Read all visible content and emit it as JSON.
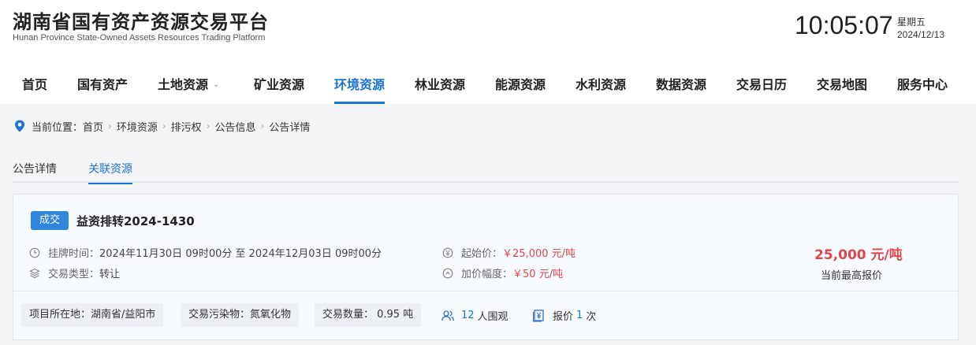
{
  "header": {
    "title": "湖南省国有资产资源交易平台",
    "subtitle": "Hunan Province State-Owned Assets Resources Trading Platform",
    "time": "10:05:07",
    "weekday": "星期五",
    "date": "2024/12/13"
  },
  "nav": {
    "items": [
      {
        "label": "首页"
      },
      {
        "label": "国有资产"
      },
      {
        "label": "土地资源"
      },
      {
        "label": "矿业资源"
      },
      {
        "label": "环境资源"
      },
      {
        "label": "林业资源"
      },
      {
        "label": "能源资源"
      },
      {
        "label": "水利资源"
      },
      {
        "label": "数据资源"
      },
      {
        "label": "交易日历"
      },
      {
        "label": "交易地图"
      },
      {
        "label": "服务中心"
      }
    ],
    "active": "环境资源"
  },
  "breadcrumb": {
    "prefix": "当前位置：",
    "items": [
      "首页",
      "环境资源",
      "排污权",
      "公告信息",
      "公告详情"
    ]
  },
  "tabs": [
    {
      "label": "公告详情"
    },
    {
      "label": "关联资源"
    }
  ],
  "card": {
    "badge": "成交",
    "title": "益资排转2024-1430",
    "listing_label": "挂牌时间：",
    "listing_value": "2024年11月30日 09时00分 至 2024年12月03日 09时00分",
    "type_label": "交易类型：",
    "type_value": "转让",
    "start_price_label": "起始价：",
    "start_price_value": "￥25,000 元/吨",
    "increment_label": "加价幅度：",
    "increment_value": "￥50 元/吨",
    "highest_price": "25,000 元/吨",
    "highest_caption": "当前最高报价",
    "chips": [
      {
        "label": "项目所在地：湖南省/益阳市"
      },
      {
        "label": "交易污染物：氮氧化物"
      },
      {
        "label": "交易数量： 0.95 吨"
      }
    ],
    "watchers_count": "12",
    "watchers_label": "人围观",
    "bids_prefix": "报价",
    "bids_count": "1",
    "bids_suffix": "次"
  },
  "colors": {
    "accent": "#1a73d9",
    "price": "#e0474c",
    "badge": "#2f86dc"
  }
}
